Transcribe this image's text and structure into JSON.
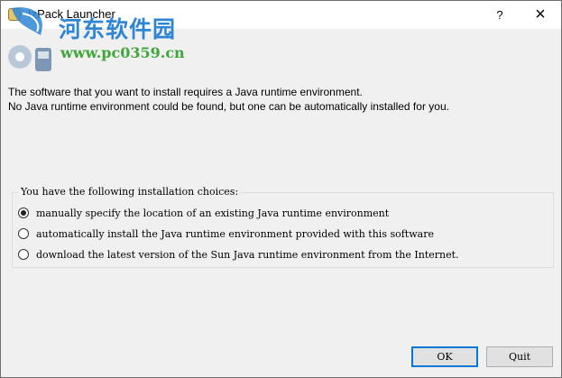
{
  "window": {
    "title": "IzPack Launcher",
    "help_label": "?",
    "close_label": "×"
  },
  "watermark": {
    "site_name": "河东软件园",
    "site_url": "www.pc0359.cn"
  },
  "message": {
    "line1": "The software that you want to install requires a Java runtime environment.",
    "line2": "No Java runtime environment could be found, but one can be automatically installed for you."
  },
  "choices": {
    "legend": "You have the following installation choices:",
    "options": [
      {
        "label": "manually specify the location of an existing Java runtime environment",
        "selected": true
      },
      {
        "label": "automatically install the Java runtime environment provided with this software",
        "selected": false
      },
      {
        "label": "download the latest version of the Sun Java runtime environment from the Internet.",
        "selected": false
      }
    ]
  },
  "buttons": {
    "ok_label": "OK",
    "quit_label": "Quit"
  },
  "colors": {
    "accent": "#0078d7",
    "watermark_blue": "#2e86d4",
    "watermark_green": "#3fa63a"
  },
  "icons": {
    "app": "java-cup-icon",
    "close": "close-icon",
    "help": "help-icon"
  }
}
